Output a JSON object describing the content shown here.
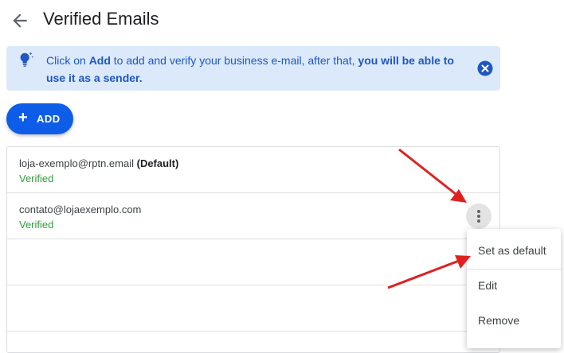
{
  "header": {
    "title": "Verified Emails"
  },
  "banner": {
    "text_1": "Click on ",
    "text_add": "Add",
    "text_2": " to add and verify your business e-mail, after that, ",
    "text_bold": "you will be able to use it as a sender."
  },
  "add_button": {
    "plus": "+",
    "label": "ADD"
  },
  "emails": [
    {
      "address": "loja-exemplo@rptn.email",
      "default_tag": "(Default)",
      "status": "Verified"
    },
    {
      "address": "contato@lojaexemplo.com",
      "status": "Verified"
    }
  ],
  "menu": {
    "items": [
      {
        "label": "Set as default"
      },
      {
        "label": "Edit"
      },
      {
        "label": "Remove"
      }
    ]
  },
  "colors": {
    "primary": "#0d5de8",
    "banner_bg": "#dbe9fb",
    "verified": "#2e9e3a",
    "annotation_arrow": "#e02020"
  },
  "icons": [
    "back-arrow-icon",
    "lightbulb-icon",
    "close-icon",
    "plus-icon",
    "more-vert-icon"
  ]
}
